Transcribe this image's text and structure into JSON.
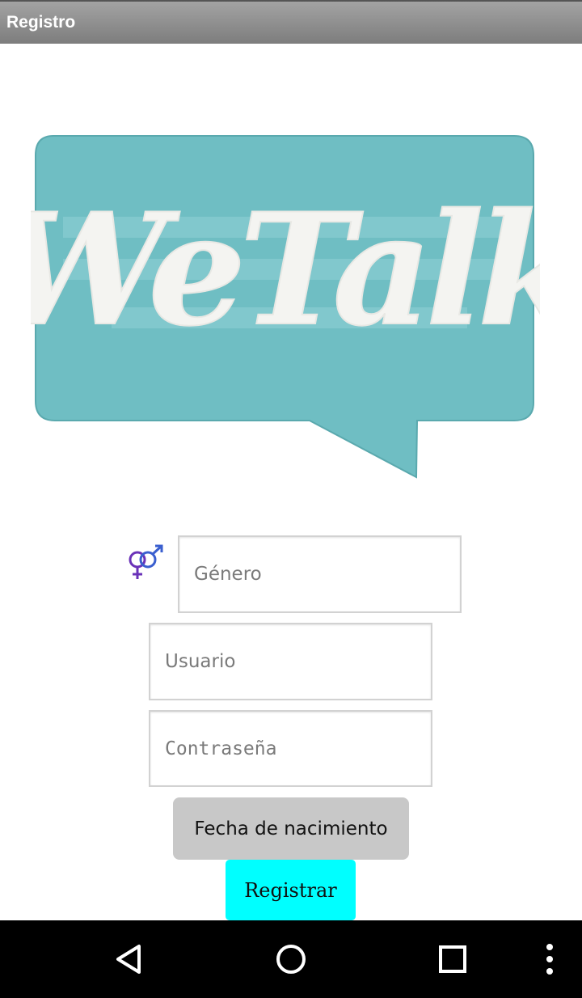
{
  "app_bar": {
    "title": "Registro"
  },
  "logo": {
    "text": "WeTalk",
    "bubble_color": "#6fbec3",
    "text_color": "#f4f4f1"
  },
  "form": {
    "genero_placeholder": "Género",
    "usuario_placeholder": "Usuario",
    "password_placeholder": "Contraseña",
    "gender_icon": "gender-symbol-icon"
  },
  "buttons": {
    "fecha_label": "Fecha de nacimiento",
    "registrar_label": "Registrar",
    "registrar_color": "#00ffff",
    "fecha_color": "#c8c8c8"
  },
  "nav_bar": {
    "back_icon": "back-triangle-icon",
    "home_icon": "home-circle-icon",
    "recents_icon": "recents-square-icon",
    "menu_icon": "overflow-menu-icon"
  }
}
